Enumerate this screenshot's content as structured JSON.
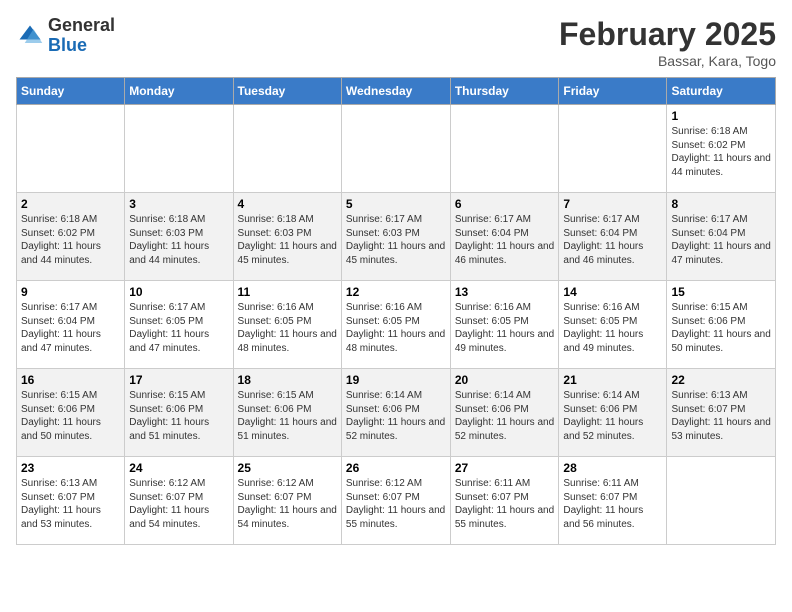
{
  "header": {
    "logo_general": "General",
    "logo_blue": "Blue",
    "month_title": "February 2025",
    "subtitle": "Bassar, Kara, Togo"
  },
  "weekdays": [
    "Sunday",
    "Monday",
    "Tuesday",
    "Wednesday",
    "Thursday",
    "Friday",
    "Saturday"
  ],
  "weeks": [
    [
      {
        "day": "",
        "info": ""
      },
      {
        "day": "",
        "info": ""
      },
      {
        "day": "",
        "info": ""
      },
      {
        "day": "",
        "info": ""
      },
      {
        "day": "",
        "info": ""
      },
      {
        "day": "",
        "info": ""
      },
      {
        "day": "1",
        "info": "Sunrise: 6:18 AM\nSunset: 6:02 PM\nDaylight: 11 hours and 44 minutes."
      }
    ],
    [
      {
        "day": "2",
        "info": "Sunrise: 6:18 AM\nSunset: 6:02 PM\nDaylight: 11 hours and 44 minutes."
      },
      {
        "day": "3",
        "info": "Sunrise: 6:18 AM\nSunset: 6:03 PM\nDaylight: 11 hours and 44 minutes."
      },
      {
        "day": "4",
        "info": "Sunrise: 6:18 AM\nSunset: 6:03 PM\nDaylight: 11 hours and 45 minutes."
      },
      {
        "day": "5",
        "info": "Sunrise: 6:17 AM\nSunset: 6:03 PM\nDaylight: 11 hours and 45 minutes."
      },
      {
        "day": "6",
        "info": "Sunrise: 6:17 AM\nSunset: 6:04 PM\nDaylight: 11 hours and 46 minutes."
      },
      {
        "day": "7",
        "info": "Sunrise: 6:17 AM\nSunset: 6:04 PM\nDaylight: 11 hours and 46 minutes."
      },
      {
        "day": "8",
        "info": "Sunrise: 6:17 AM\nSunset: 6:04 PM\nDaylight: 11 hours and 47 minutes."
      }
    ],
    [
      {
        "day": "9",
        "info": "Sunrise: 6:17 AM\nSunset: 6:04 PM\nDaylight: 11 hours and 47 minutes."
      },
      {
        "day": "10",
        "info": "Sunrise: 6:17 AM\nSunset: 6:05 PM\nDaylight: 11 hours and 47 minutes."
      },
      {
        "day": "11",
        "info": "Sunrise: 6:16 AM\nSunset: 6:05 PM\nDaylight: 11 hours and 48 minutes."
      },
      {
        "day": "12",
        "info": "Sunrise: 6:16 AM\nSunset: 6:05 PM\nDaylight: 11 hours and 48 minutes."
      },
      {
        "day": "13",
        "info": "Sunrise: 6:16 AM\nSunset: 6:05 PM\nDaylight: 11 hours and 49 minutes."
      },
      {
        "day": "14",
        "info": "Sunrise: 6:16 AM\nSunset: 6:05 PM\nDaylight: 11 hours and 49 minutes."
      },
      {
        "day": "15",
        "info": "Sunrise: 6:15 AM\nSunset: 6:06 PM\nDaylight: 11 hours and 50 minutes."
      }
    ],
    [
      {
        "day": "16",
        "info": "Sunrise: 6:15 AM\nSunset: 6:06 PM\nDaylight: 11 hours and 50 minutes."
      },
      {
        "day": "17",
        "info": "Sunrise: 6:15 AM\nSunset: 6:06 PM\nDaylight: 11 hours and 51 minutes."
      },
      {
        "day": "18",
        "info": "Sunrise: 6:15 AM\nSunset: 6:06 PM\nDaylight: 11 hours and 51 minutes."
      },
      {
        "day": "19",
        "info": "Sunrise: 6:14 AM\nSunset: 6:06 PM\nDaylight: 11 hours and 52 minutes."
      },
      {
        "day": "20",
        "info": "Sunrise: 6:14 AM\nSunset: 6:06 PM\nDaylight: 11 hours and 52 minutes."
      },
      {
        "day": "21",
        "info": "Sunrise: 6:14 AM\nSunset: 6:06 PM\nDaylight: 11 hours and 52 minutes."
      },
      {
        "day": "22",
        "info": "Sunrise: 6:13 AM\nSunset: 6:07 PM\nDaylight: 11 hours and 53 minutes."
      }
    ],
    [
      {
        "day": "23",
        "info": "Sunrise: 6:13 AM\nSunset: 6:07 PM\nDaylight: 11 hours and 53 minutes."
      },
      {
        "day": "24",
        "info": "Sunrise: 6:12 AM\nSunset: 6:07 PM\nDaylight: 11 hours and 54 minutes."
      },
      {
        "day": "25",
        "info": "Sunrise: 6:12 AM\nSunset: 6:07 PM\nDaylight: 11 hours and 54 minutes."
      },
      {
        "day": "26",
        "info": "Sunrise: 6:12 AM\nSunset: 6:07 PM\nDaylight: 11 hours and 55 minutes."
      },
      {
        "day": "27",
        "info": "Sunrise: 6:11 AM\nSunset: 6:07 PM\nDaylight: 11 hours and 55 minutes."
      },
      {
        "day": "28",
        "info": "Sunrise: 6:11 AM\nSunset: 6:07 PM\nDaylight: 11 hours and 56 minutes."
      },
      {
        "day": "",
        "info": ""
      }
    ]
  ]
}
